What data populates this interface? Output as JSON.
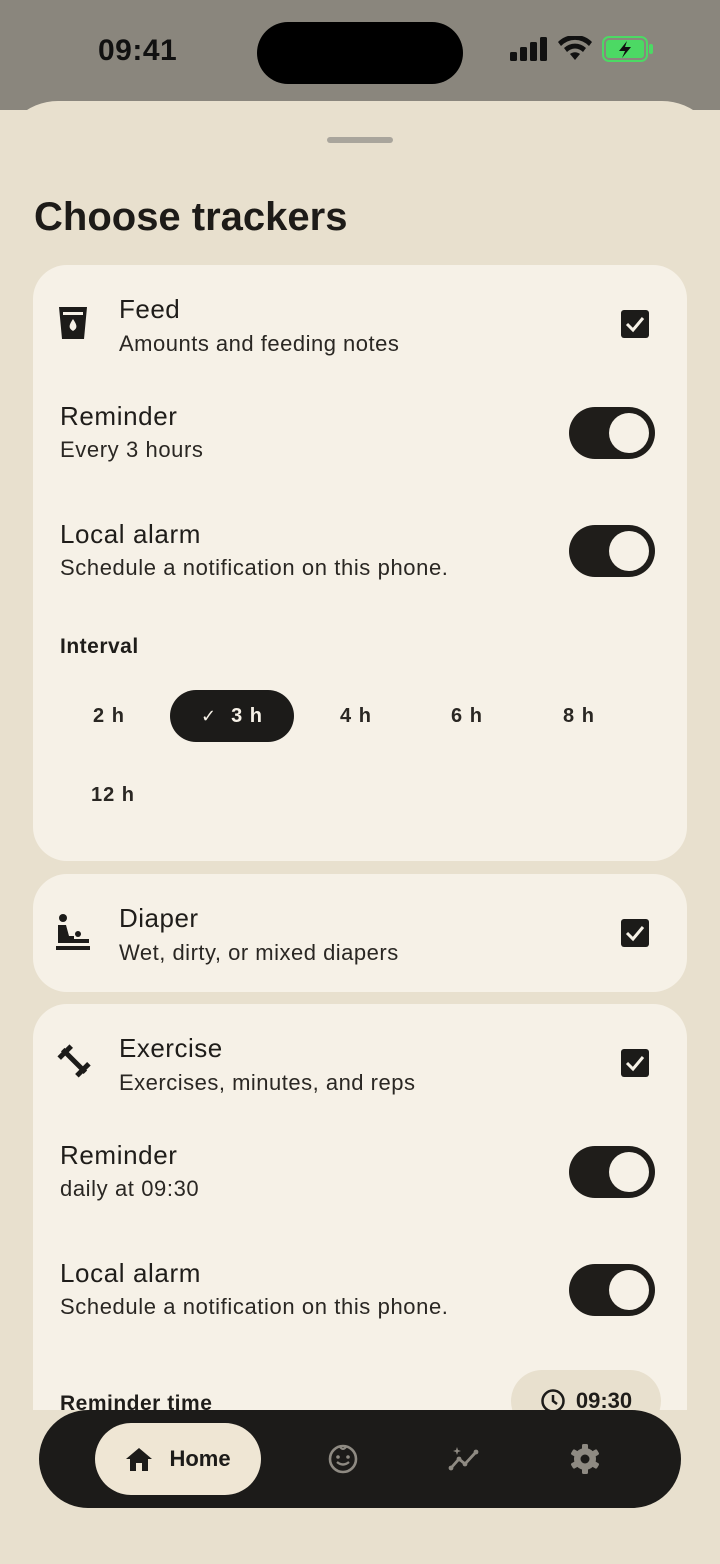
{
  "status_bar": {
    "time": "09:41"
  },
  "sheet": {
    "title": "Choose trackers"
  },
  "trackers": {
    "feed": {
      "title": "Feed",
      "subtitle": "Amounts and feeding notes",
      "icon": "cup-icon",
      "checked": true,
      "reminder": {
        "title": "Reminder",
        "subtitle": "Every 3 hours",
        "enabled": true
      },
      "local_alarm": {
        "title": "Local alarm",
        "subtitle": "Schedule a notification on this phone.",
        "enabled": true
      },
      "interval": {
        "label": "Interval",
        "options": [
          "2 h",
          "3 h",
          "4 h",
          "6 h",
          "8 h",
          "12 h"
        ],
        "selected": "3 h"
      }
    },
    "diaper": {
      "title": "Diaper",
      "subtitle": "Wet, dirty, or mixed diapers",
      "icon": "baby-changing-icon",
      "checked": true
    },
    "exercise": {
      "title": "Exercise",
      "subtitle": "Exercises, minutes, and reps",
      "icon": "dumbbell-icon",
      "checked": true,
      "reminder": {
        "title": "Reminder",
        "subtitle": "daily at 09:30",
        "enabled": true
      },
      "local_alarm": {
        "title": "Local alarm",
        "subtitle": "Schedule a notification on this phone.",
        "enabled": true
      },
      "reminder_time": {
        "label": "Reminder time",
        "value": "09:30"
      }
    }
  },
  "nav": {
    "home_label": "Home",
    "items": [
      "home-icon",
      "baby-face-icon",
      "insights-icon",
      "settings-gear-icon"
    ],
    "active": "Home"
  },
  "colors": {
    "background": "#e8e0ce",
    "card": "#f6f1e7",
    "dark": "#1c1b19",
    "battery_green": "#4cd964"
  }
}
